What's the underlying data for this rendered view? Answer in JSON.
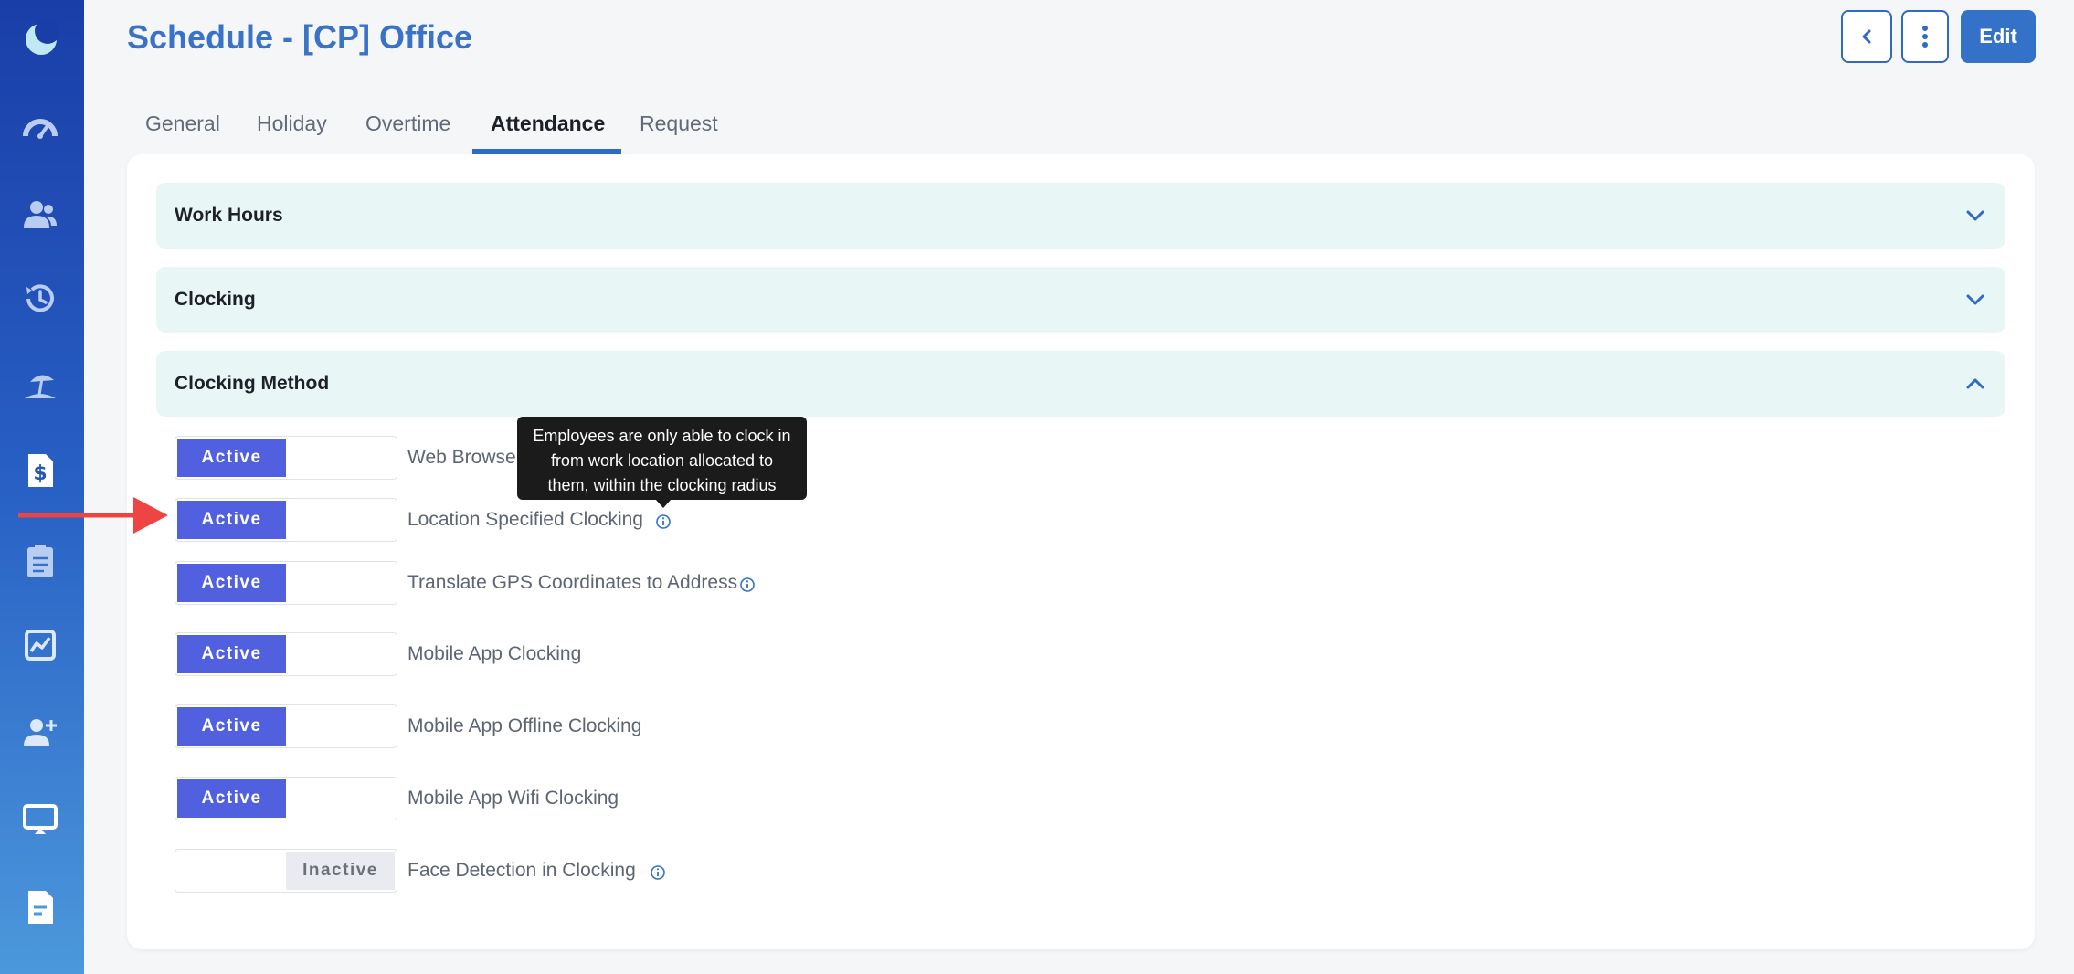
{
  "header": {
    "title": "Schedule - [CP] Office",
    "edit_label": "Edit"
  },
  "tabs": [
    {
      "label": "General"
    },
    {
      "label": "Holiday"
    },
    {
      "label": "Overtime"
    },
    {
      "label": "Attendance",
      "active": true
    },
    {
      "label": "Request"
    }
  ],
  "sections": [
    {
      "title": "Work Hours",
      "expanded": false
    },
    {
      "title": "Clocking",
      "expanded": false
    },
    {
      "title": "Clocking Method",
      "expanded": true
    }
  ],
  "clocking_methods": [
    {
      "label": "Web Browser C",
      "state": "Active"
    },
    {
      "label": "Location Specified Clocking",
      "state": "Active"
    },
    {
      "label": "Translate GPS Coordinates to Address",
      "state": "Active"
    },
    {
      "label": "Mobile App Clocking",
      "state": "Active"
    },
    {
      "label": "Mobile App Offline Clocking",
      "state": "Active"
    },
    {
      "label": "Mobile App Wifi Clocking",
      "state": "Active"
    },
    {
      "label": "Face Detection in Clocking",
      "state": "Inactive"
    }
  ],
  "tooltip": {
    "line1": "Employees are only able to clock in",
    "line2": "from work location allocated to",
    "line3": "them, within the clocking radius"
  },
  "sidebar": {
    "icons": [
      "app-logo-icon",
      "dashboard-icon",
      "employees-icon",
      "attendance-history-icon",
      "leave-icon",
      "payroll-icon",
      "tasks-icon",
      "reports-icon",
      "add-user-icon",
      "screen-icon",
      "documents-icon"
    ]
  },
  "colors": {
    "sidebar_top": "#1a3ea8",
    "sidebar_bottom": "#4c98dc",
    "accent": "#2f6ac4",
    "active_toggle": "#5160df",
    "section_bg": "#e8f6f6",
    "annotation_arrow": "#ef4444"
  }
}
